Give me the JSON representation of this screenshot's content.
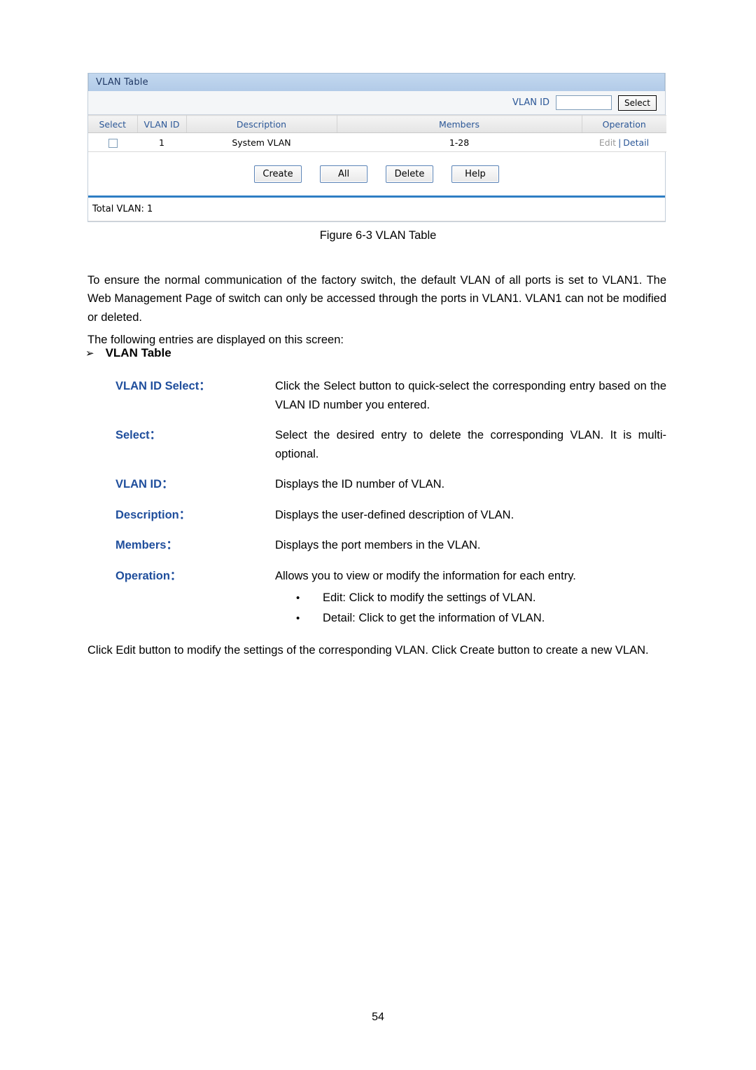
{
  "figure": {
    "panel_title": "VLAN Table",
    "search": {
      "label": "VLAN ID",
      "value": "",
      "placeholder": "",
      "button_label": "Select"
    },
    "table": {
      "columns": [
        "Select",
        "VLAN ID",
        "Description",
        "Members",
        "Operation"
      ],
      "rows": [
        {
          "select": "",
          "vlan_id": "1",
          "description": "System VLAN",
          "members": "1-28",
          "operation_edit": "Edit",
          "operation_separator": "|",
          "operation_detail": "Detail"
        }
      ]
    },
    "buttons": [
      {
        "label": "Create"
      },
      {
        "label": "All"
      },
      {
        "label": "Delete"
      },
      {
        "label": "Help"
      }
    ],
    "total_label": "Total VLAN: 1",
    "caption": "Figure 6-3 VLAN Table"
  },
  "content": {
    "intro_paragraph": "To ensure the normal communication of the factory switch, the default VLAN of all ports is set to VLAN1. The Web Management Page of switch can only be accessed through the ports in VLAN1. VLAN1 can not be modified or deleted.",
    "entries_paragraph": "The following entries are displayed on this screen:",
    "section_bullet": "➢",
    "section_heading": "VLAN Table",
    "definitions": [
      {
        "term": "VLAN ID Select：",
        "description": "Click the Select button to quick-select the corresponding entry based on the VLAN ID number you entered."
      },
      {
        "term": "Select：",
        "description": "Select the desired entry to delete the corresponding VLAN. It is multi-optional."
      },
      {
        "term": "VLAN ID：",
        "description": "Displays the ID number of VLAN."
      },
      {
        "term": "Description：",
        "description": "Displays the user-defined description of VLAN."
      },
      {
        "term": "Members：",
        "description": "Displays the port members in the VLAN."
      },
      {
        "term": "Operation：",
        "description": "Allows you to view or modify the information for each entry.",
        "sub_bullets": [
          "Edit: Click to modify the settings of VLAN.",
          "Detail: Click to get the information of VLAN."
        ]
      }
    ],
    "closing_paragraph": "Click Edit button to modify the settings of the corresponding VLAN. Click Create button to create a new VLAN."
  },
  "page_number": "54",
  "colors": {
    "title_bar": "#b9d0ea",
    "title_text": "#1f3864",
    "header_text": "#2b5797",
    "link_blue": "#2b5797",
    "disabled_gray": "#999999",
    "rule_blue": "#2f7ec4",
    "term_blue": "#1f4e9c"
  }
}
